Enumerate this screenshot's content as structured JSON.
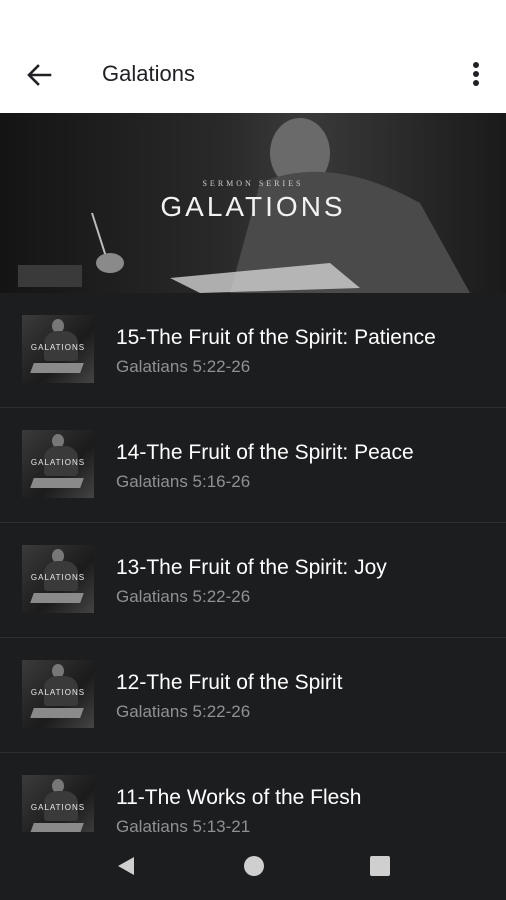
{
  "header": {
    "title": "Galations",
    "back_icon": "arrow-left-icon",
    "more_icon": "more-vert-icon"
  },
  "banner": {
    "subtitle": "SERMON SERIES",
    "title": "GALATIONS"
  },
  "sermons": [
    {
      "title": "15-The Fruit of the Spirit: Patience",
      "reference": "Galatians 5:22-26",
      "thumb_text": "GALATIONS"
    },
    {
      "title": "14-The Fruit of the Spirit: Peace",
      "reference": "Galatians 5:16-26",
      "thumb_text": "GALATIONS"
    },
    {
      "title": "13-The Fruit of the Spirit: Joy",
      "reference": "Galatians 5:22-26",
      "thumb_text": "GALATIONS"
    },
    {
      "title": "12-The Fruit of the Spirit",
      "reference": "Galatians 5:22-26",
      "thumb_text": "GALATIONS"
    },
    {
      "title": "11-The Works of the Flesh",
      "reference": "Galatians 5:13-21",
      "thumb_text": "GALATIONS"
    }
  ],
  "navigation": {
    "back_icon": "triangle-back-icon",
    "home_icon": "circle-home-icon",
    "recents_icon": "square-recents-icon"
  },
  "colors": {
    "background": "#1c1d1f",
    "appbar": "#ffffff",
    "title_text": "#ffffff",
    "subtitle_text": "#8f9193"
  }
}
